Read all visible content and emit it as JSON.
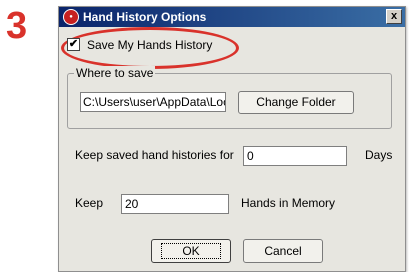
{
  "annotation": {
    "step_number": "3",
    "highlight_color": "#d9322b"
  },
  "window": {
    "title": "Hand History Options",
    "icon": "app-logo-icon",
    "close_glyph": "x"
  },
  "save_history": {
    "label": "Save My Hands History",
    "checked": true,
    "check_glyph": "✔"
  },
  "where_to_save": {
    "legend": "Where to save",
    "path_value": "C:\\Users\\user\\AppData\\Loc",
    "change_folder_label": "Change Folder"
  },
  "keep_days": {
    "label": "Keep saved hand histories for",
    "value": "0",
    "unit": "Days"
  },
  "keep_hands": {
    "label": "Keep",
    "value": "20",
    "unit": "Hands in Memory"
  },
  "buttons": {
    "ok_label": "OK",
    "cancel_label": "Cancel"
  },
  "colors": {
    "titlebar_start": "#0a246a",
    "titlebar_end": "#3a6ea5",
    "dialog_bg": "#e7e6e0"
  }
}
